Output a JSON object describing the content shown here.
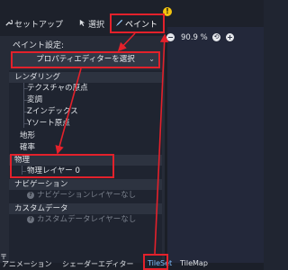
{
  "toolbar": {
    "setup_label": "セットアップ",
    "select_label": "選択",
    "paint_label": "ペイント",
    "warning_glyph": "!"
  },
  "panel": {
    "paint_settings_label": "ペイント設定:",
    "dropdown_value": "プロパティエディターを選択",
    "categories": {
      "rendering": "レンダリング",
      "physics": "物理",
      "navigation": "ナビゲーション",
      "custom_data": "カスタムデータ"
    },
    "items": {
      "texture_origin": "テクスチャの原点",
      "modulate": "変調",
      "z_index": "Zインデックス",
      "y_sort_origin": "Yソート原点",
      "terrain": "地形",
      "probability": "確率",
      "physics_layer_0": "物理レイヤー 0",
      "nav_layer_none": "ナビゲーションレイヤーなし",
      "custom_data_layer_none": "カスタムデータレイヤーなし"
    }
  },
  "viewport": {
    "zoom_value": "90.9 %"
  },
  "bottom_tabs": {
    "animation": "アニメーション",
    "shader_editor": "シェーダーエディター",
    "tileset": "TileSet",
    "tilemap": "TileMap"
  },
  "colors": {
    "annotation_red": "#e3212b",
    "panel_bg": "#262b37",
    "toolbar_bg": "#1d212b"
  }
}
